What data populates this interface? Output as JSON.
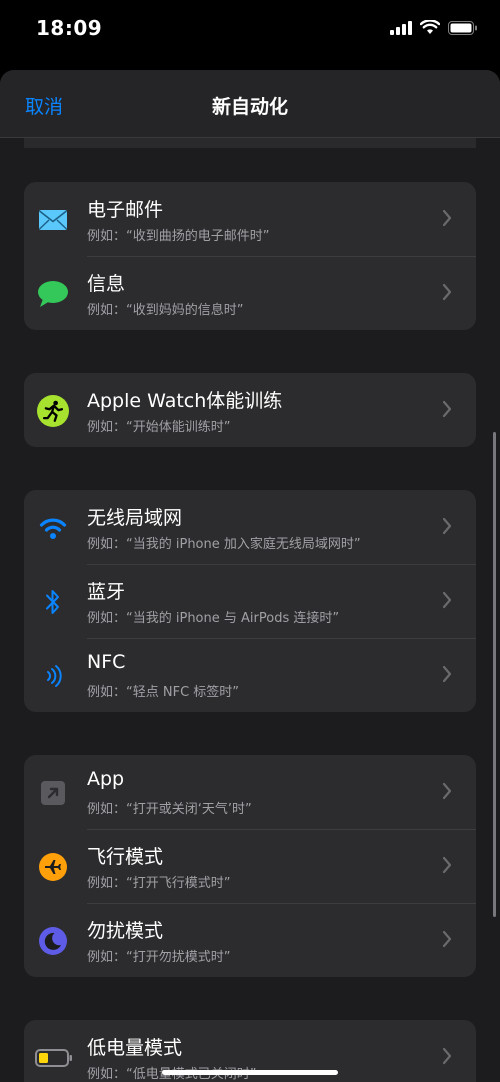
{
  "status_bar": {
    "time": "18:09"
  },
  "nav": {
    "cancel_label": "取消",
    "title": "新自动化"
  },
  "groups": [
    {
      "rows": [
        {
          "icon": "mail-icon",
          "title": "电子邮件",
          "subtitle": "例如：“收到曲扬的电子邮件时”"
        },
        {
          "icon": "messages-icon",
          "title": "信息",
          "subtitle": "例如：“收到妈妈的信息时”"
        }
      ]
    },
    {
      "rows": [
        {
          "icon": "workout-icon",
          "title": "Apple Watch体能训练",
          "subtitle": "例如：“开始体能训练时”"
        }
      ]
    },
    {
      "rows": [
        {
          "icon": "wifi-icon",
          "title": "无线局域网",
          "subtitle": "例如：“当我的 iPhone 加入家庭无线局域网时”"
        },
        {
          "icon": "bluetooth-icon",
          "title": "蓝牙",
          "subtitle": "例如：“当我的 iPhone 与 AirPods 连接时”"
        },
        {
          "icon": "nfc-icon",
          "title": "NFC",
          "subtitle": "例如：“轻点 NFC 标签时”"
        }
      ]
    },
    {
      "rows": [
        {
          "icon": "app-arrow-icon",
          "title": "App",
          "subtitle": "例如：“打开或关闭‘天气’时”"
        },
        {
          "icon": "airplane-icon",
          "title": "飞行模式",
          "subtitle": "例如：“打开飞行模式时”"
        },
        {
          "icon": "moon-icon",
          "title": "勿扰模式",
          "subtitle": "例如：“打开勿扰模式时”"
        }
      ]
    },
    {
      "rows": [
        {
          "icon": "low-battery-icon",
          "title": "低电量模式",
          "subtitle": "例如：“低电量模式已关闭时”"
        }
      ]
    }
  ],
  "colors": {
    "accent": "#0a84ff",
    "mail": "#5ac8fa",
    "messages": "#34c759",
    "workout": "#a6e22e",
    "airplane": "#ff9f0a",
    "moon": "#5e5ce6",
    "battery": "#ffd60a"
  }
}
